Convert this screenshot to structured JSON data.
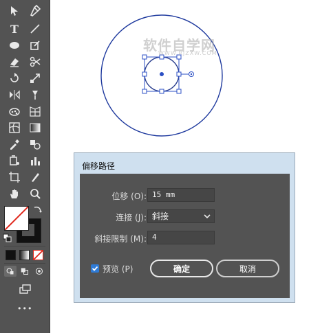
{
  "watermark": {
    "main": "软件自学网",
    "sub": "WWW.RJZXW.COM"
  },
  "dialog": {
    "title": "偏移路径",
    "offset": {
      "label": "位移 (O):",
      "value": "15 mm"
    },
    "joins": {
      "label": "连接 (J):",
      "value": "斜接"
    },
    "miter_limit": {
      "label": "斜接限制 (M):",
      "value": "4"
    },
    "preview": {
      "label": "预览 (P)",
      "checked": true
    },
    "ok_label": "确定",
    "cancel_label": "取消"
  },
  "toolbar": {
    "more_label": "•••"
  },
  "colors": {
    "panel": "#535353",
    "selection": "#2b4fc4",
    "circle_stroke": "#1f3a9e",
    "checkbox": "#2f7bd6"
  }
}
